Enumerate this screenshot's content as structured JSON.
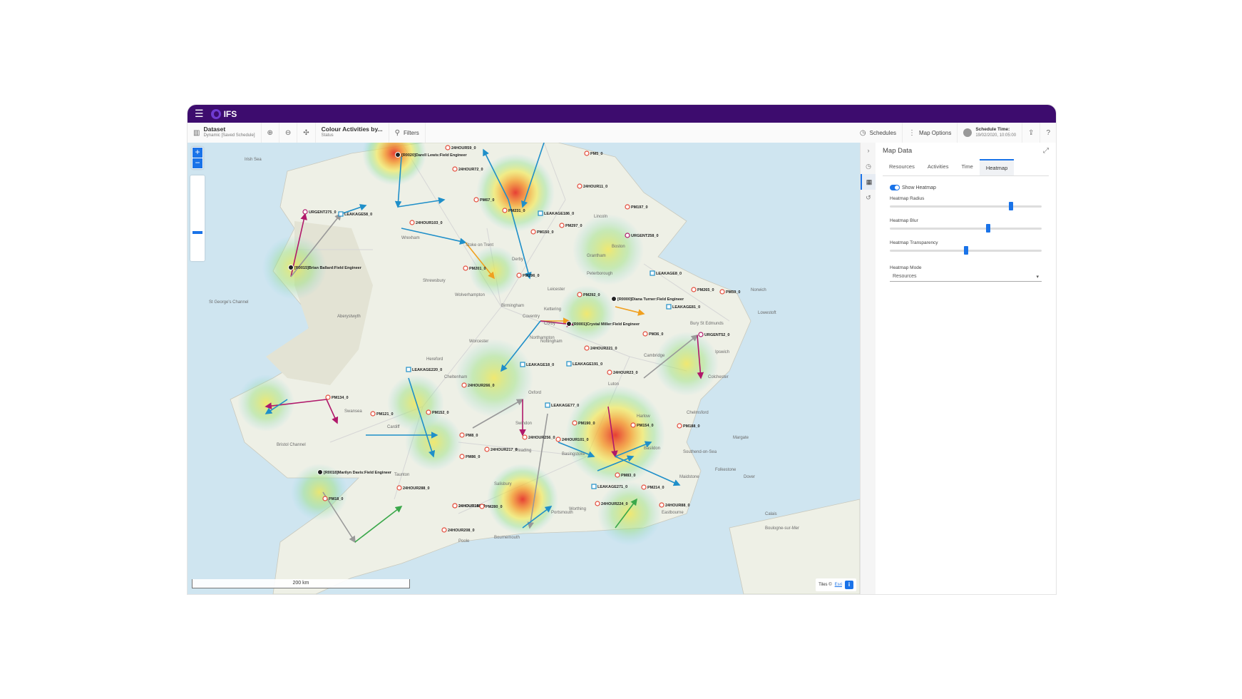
{
  "app": {
    "brand": "IFS"
  },
  "toolbar": {
    "dataset_label": "Dataset",
    "dataset_sub": "Dynamic [Saved Schedule]",
    "colour_label": "Colour Activities by...",
    "colour_sub": "Status",
    "filters_label": "Filters",
    "schedules_label": "Schedules",
    "map_options_label": "Map Options",
    "schedule_time_label": "Schedule Time:",
    "schedule_time_value": "19/02/2020, 10:05:00"
  },
  "map": {
    "scale_label": "200 km",
    "attribution_text": "Tiles ©",
    "attribution_link": "Esri",
    "info_label": "i",
    "places": [
      "Birmingham",
      "Cardiff",
      "Oxford",
      "Cambridge",
      "Leicester",
      "Nottingham",
      "Coventry",
      "Worcester",
      "Hereford",
      "Cheltenham",
      "Swindon",
      "Reading",
      "Basingstoke",
      "Salisbury",
      "Bournemouth",
      "Poole",
      "Chelmsford",
      "Colchester",
      "Ipswich",
      "Norwich",
      "Derby",
      "Stoke on Trent",
      "Wrexham",
      "Shrewsbury",
      "Wolverhampton",
      "Lincoln",
      "Boston",
      "Grantham",
      "Aberystwyth",
      "Swansea",
      "Taunton",
      "Southend-on-Sea",
      "Maidstone",
      "Folkestone",
      "Margate",
      "Eastbourne",
      "Portsmouth",
      "Luton",
      "Harlow",
      "Basildon",
      "Peterborough",
      "Lowestoft",
      "Irish Sea",
      "St George's Channel",
      "Bristol Channel",
      "Worthing",
      "Kettering",
      "Corby",
      "Northampton",
      "Bury St Edmunds",
      "Dover",
      "Calais",
      "Boulogne-sur-Mer"
    ],
    "labels": [
      "[R0020]Darell Lewis:Field Engineer",
      "24HOUR59_0",
      "24HOUR72_0",
      "PM5_0",
      "URGENT275_0",
      "LEAKAGE58_0",
      "[R0015]Brian Ballard:Field Engineer",
      "24HOUR103_0",
      "PM67_0",
      "PM231_0",
      "LEAKAGE186_0",
      "PM150_0",
      "PM297_0",
      "24HOUR11_0",
      "PM197_0",
      "URGENT258_0",
      "PM201_0",
      "PM296_0",
      "PM292_0",
      "[R0000]Diana Turner:Field Engineer",
      "LEAKAGE81_0",
      "LEAKAGE8_0",
      "PM265_0",
      "PM59_0",
      "[R0001]Crystal Miller:Field Engineer",
      "PM36_0",
      "URGENT52_0",
      "24HOUR221_0",
      "LEAKAGE18_0",
      "LEAKAGE191_0",
      "24HOUR23_0",
      "LEAKAGE220_0",
      "PM134_0",
      "PM121_0",
      "PM152_0",
      "24HOUR266_0",
      "LEAKAGE77_0",
      "PM190_0",
      "PM154_0",
      "PM188_0",
      "PM8_0",
      "PM86_0",
      "24HOUR217_0",
      "24HOUR256_0",
      "24HOUR101_0",
      "PM83_0",
      "24HOUR150_0",
      "LEAKAGE271_0",
      "PM214_0",
      "24HOUR88_0",
      "24HOUR224_0",
      "[R0018]Marilyn Davis:Field Engineer",
      "24HOUR288_0",
      "PM18_0",
      "24HOUR148_0",
      "PM280_0",
      "24HOUR208_0"
    ]
  },
  "panel": {
    "title": "Map Data",
    "tabs": [
      "Resources",
      "Activities",
      "Time",
      "Heatmap"
    ],
    "active_tab": "Heatmap",
    "show_heatmap_label": "Show Heatmap",
    "show_heatmap": true,
    "radius_label": "Heatmap Radius",
    "radius_value": 0.8,
    "blur_label": "Heatmap Blur",
    "blur_value": 0.65,
    "transparency_label": "Heatmap Transparency",
    "transparency_value": 0.5,
    "mode_label": "Heatmap Mode",
    "mode_value": "Resources"
  },
  "colors": {
    "brand": "#3d0c6e",
    "accent": "#1a73e8",
    "route_blue": "#1f8fc9",
    "route_orange": "#f0a020",
    "route_purple": "#b0186a",
    "route_green": "#3aa84a",
    "route_grey": "#999999"
  }
}
